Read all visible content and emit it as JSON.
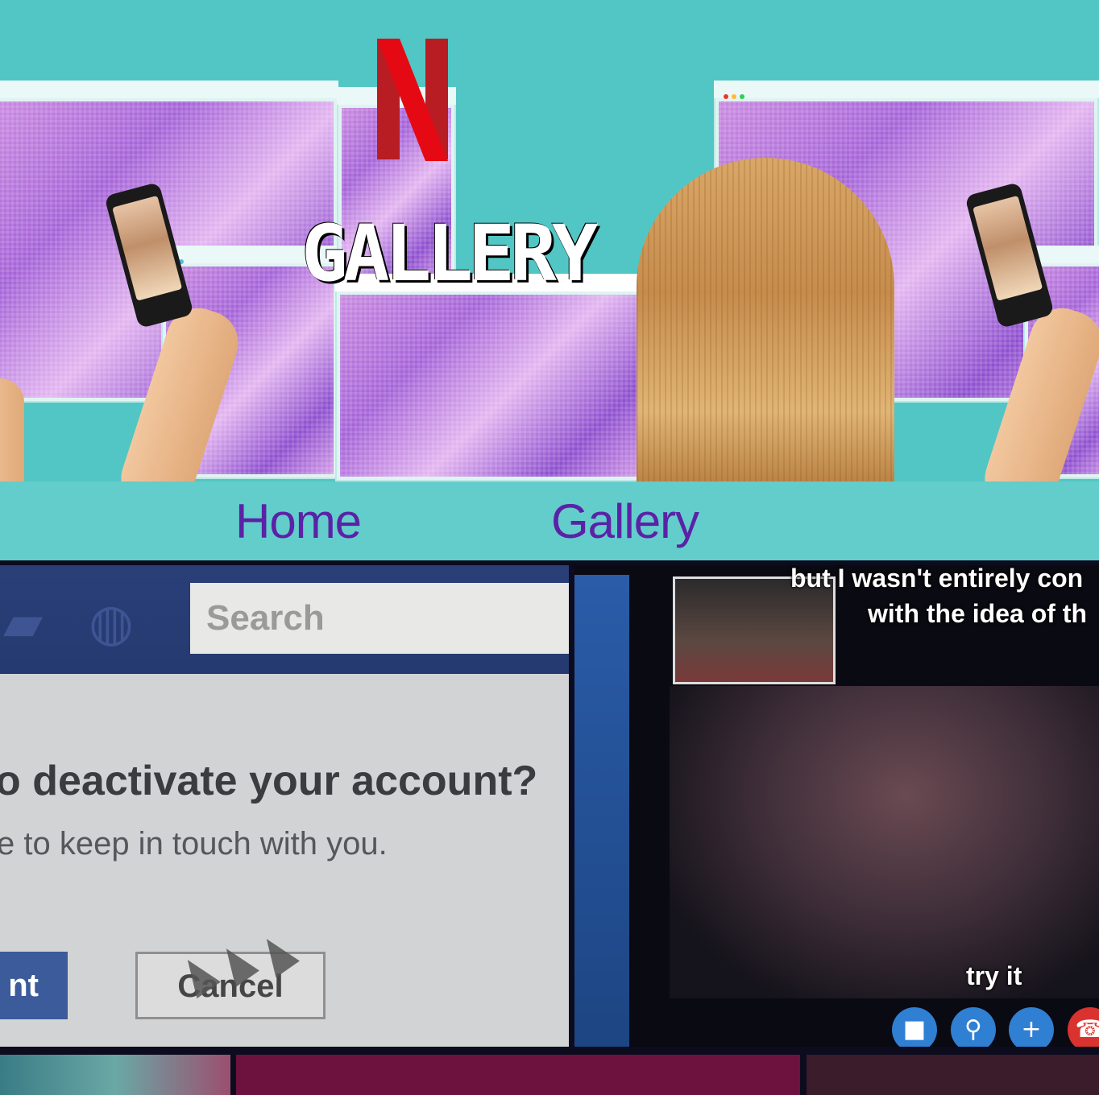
{
  "hero": {
    "logo_letter": "N",
    "title": "GALLERY",
    "colors": {
      "background": "#52c6c4",
      "logo": "#d2232a",
      "accent_purple": "#b36ad9"
    }
  },
  "nav": {
    "items": [
      {
        "label": "Home"
      },
      {
        "label": "Gallery"
      }
    ],
    "color": "#5b22a6"
  },
  "gallery": {
    "deactivate_tile": {
      "search_placeholder": "Search",
      "question": "o deactivate your account?",
      "subtext": "e to keep in touch with you.",
      "confirm_button": "nt",
      "cancel_button": "Cancel"
    },
    "video_call_tile": {
      "caption_line1": "but I wasn't entirely con",
      "caption_line2": "with the idea of th",
      "caption_line3": "try it",
      "controls": [
        {
          "icon": "video-camera-icon",
          "glyph": "■"
        },
        {
          "icon": "microphone-icon",
          "glyph": "🎙"
        },
        {
          "icon": "plus-icon",
          "glyph": "+"
        },
        {
          "icon": "hang-up-icon",
          "glyph": "☎"
        }
      ]
    }
  }
}
